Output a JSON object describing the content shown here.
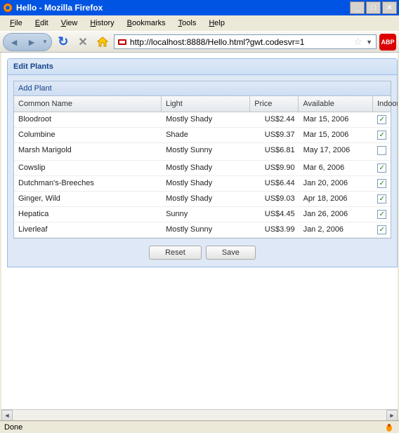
{
  "window": {
    "title": "Hello - Mozilla Firefox"
  },
  "menu": {
    "file": "File",
    "edit": "Edit",
    "view": "View",
    "history": "History",
    "bookmarks": "Bookmarks",
    "tools": "Tools",
    "help": "Help"
  },
  "url": "http://localhost:8888/Hello.html?gwt.codesvr=1",
  "panel": {
    "title": "Edit Plants",
    "add_button": "Add Plant"
  },
  "columns": {
    "name": "Common Name",
    "light": "Light",
    "price": "Price",
    "available": "Available",
    "indoor": "Indoor"
  },
  "rows": [
    {
      "name": "Bloodroot",
      "light": "Mostly Shady",
      "price": "US$2.44",
      "available": "Mar 15, 2006",
      "indoor": true
    },
    {
      "name": "Columbine",
      "light": "Shade",
      "price": "US$9.37",
      "available": "Mar 15, 2006",
      "indoor": true
    },
    {
      "name": "Marsh Marigold",
      "light": "Mostly Sunny",
      "price": "US$6.81",
      "available": "May 17, 2006",
      "indoor": false
    },
    {
      "name": "Cowslip",
      "light": "Mostly Shady",
      "price": "US$9.90",
      "available": "Mar 6, 2006",
      "indoor": true
    },
    {
      "name": "Dutchman's-Breeches",
      "light": "Mostly Shady",
      "price": "US$6.44",
      "available": "Jan 20, 2006",
      "indoor": true
    },
    {
      "name": "Ginger, Wild",
      "light": "Mostly Shady",
      "price": "US$9.03",
      "available": "Apr 18, 2006",
      "indoor": true
    },
    {
      "name": "Hepatica",
      "light": "Sunny",
      "price": "US$4.45",
      "available": "Jan 26, 2006",
      "indoor": true
    },
    {
      "name": "Liverleaf",
      "light": "Mostly Sunny",
      "price": "US$3.99",
      "available": "Jan 2, 2006",
      "indoor": true
    }
  ],
  "buttons": {
    "reset": "Reset",
    "save": "Save"
  },
  "status": "Done"
}
